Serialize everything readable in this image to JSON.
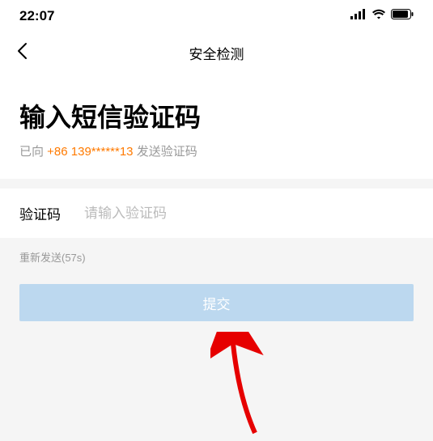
{
  "status": {
    "time": "22:07"
  },
  "nav": {
    "title": "安全检测"
  },
  "header": {
    "heading": "输入短信验证码",
    "sent_prefix": "已向 ",
    "phone": "+86 139******13",
    "sent_suffix": " 发送验证码"
  },
  "form": {
    "code_label": "验证码",
    "code_placeholder": "请输入验证码",
    "resend_text": "重新发送(57s)",
    "submit_label": "提交"
  }
}
